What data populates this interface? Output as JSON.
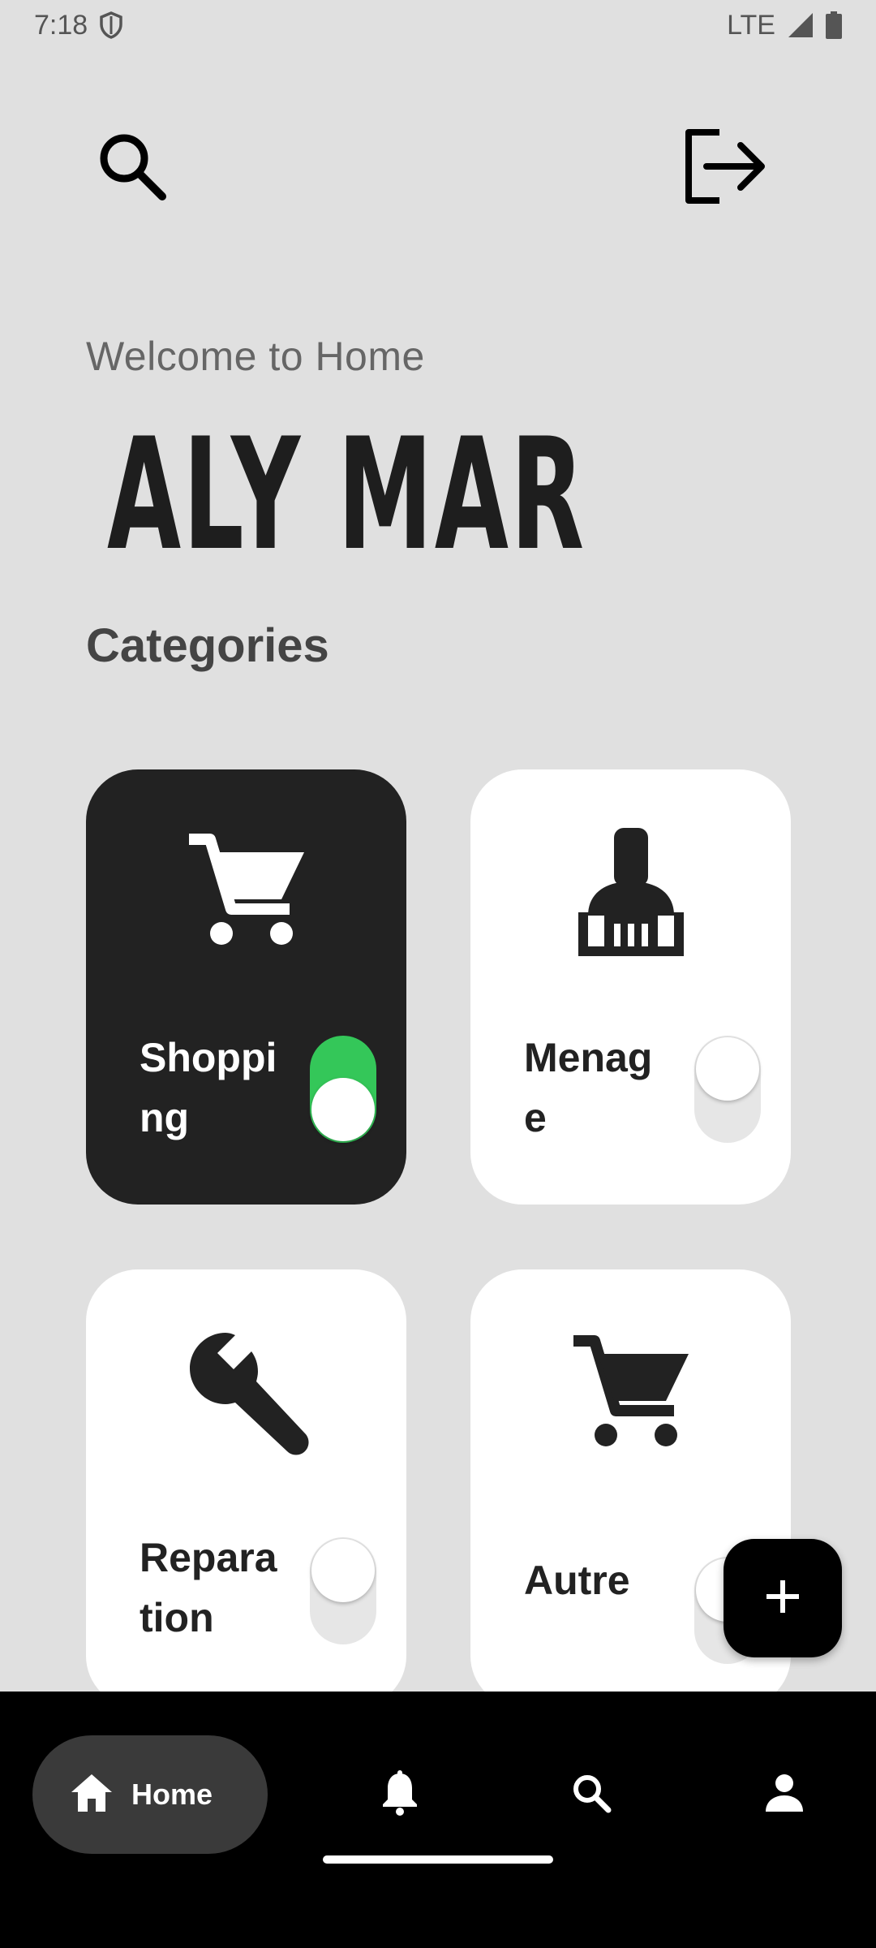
{
  "status_bar": {
    "time": "7:18",
    "network": "LTE",
    "icons": [
      "shield-icon",
      "signal-icon",
      "battery-icon"
    ]
  },
  "header": {
    "search_icon": "search-icon",
    "logout_icon": "logout-icon"
  },
  "welcome_text": "Welcome to Home",
  "user_name": "ALY MAR",
  "categories_title": "Categories",
  "categories": [
    {
      "label": "Shopping",
      "icon": "shopping-cart-icon",
      "enabled": true
    },
    {
      "label": "Menage",
      "icon": "cleaning-brush-icon",
      "enabled": false
    },
    {
      "label": "Reparation",
      "icon": "wrench-icon",
      "enabled": false
    },
    {
      "label": "Autre",
      "icon": "shopping-cart-icon",
      "enabled": false
    }
  ],
  "fab": {
    "icon": "plus-icon"
  },
  "bottom_nav": {
    "home_label": "Home",
    "items": [
      "home-icon",
      "notifications-icon",
      "search-icon",
      "profile-icon"
    ]
  },
  "colors": {
    "background": "#e0e0e0",
    "active_card": "#222222",
    "card": "#ffffff",
    "toggle_on": "#34c759",
    "nav_bar": "#000000",
    "nav_pill": "#3a3a3a"
  }
}
